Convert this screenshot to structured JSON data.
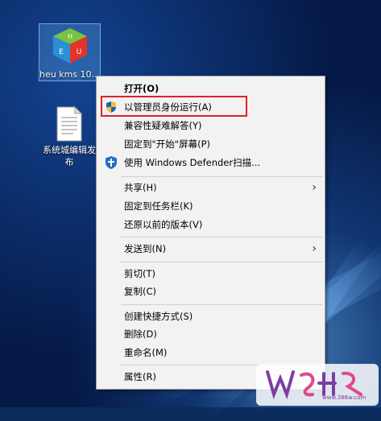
{
  "desktop": {
    "icons": [
      {
        "label": "heu kms 10..."
      },
      {
        "label": "系统城编辑发布"
      }
    ]
  },
  "context_menu": {
    "items": [
      {
        "label": "打开(O)"
      },
      {
        "label": "以管理员身份运行(A)"
      },
      {
        "label": "兼容性疑难解答(Y)"
      },
      {
        "label": "固定到\"开始\"屏幕(P)"
      },
      {
        "label": "使用 Windows Defender扫描..."
      },
      {
        "label": "共享(H)"
      },
      {
        "label": "固定到任务栏(K)"
      },
      {
        "label": "还原以前的版本(V)"
      },
      {
        "label": "发送到(N)"
      },
      {
        "label": "剪切(T)"
      },
      {
        "label": "复制(C)"
      },
      {
        "label": "创建快捷方式(S)"
      },
      {
        "label": "删除(D)"
      },
      {
        "label": "重命名(M)"
      },
      {
        "label": "属性(R)"
      }
    ]
  },
  "watermark": {
    "text": "www.386w.com"
  }
}
